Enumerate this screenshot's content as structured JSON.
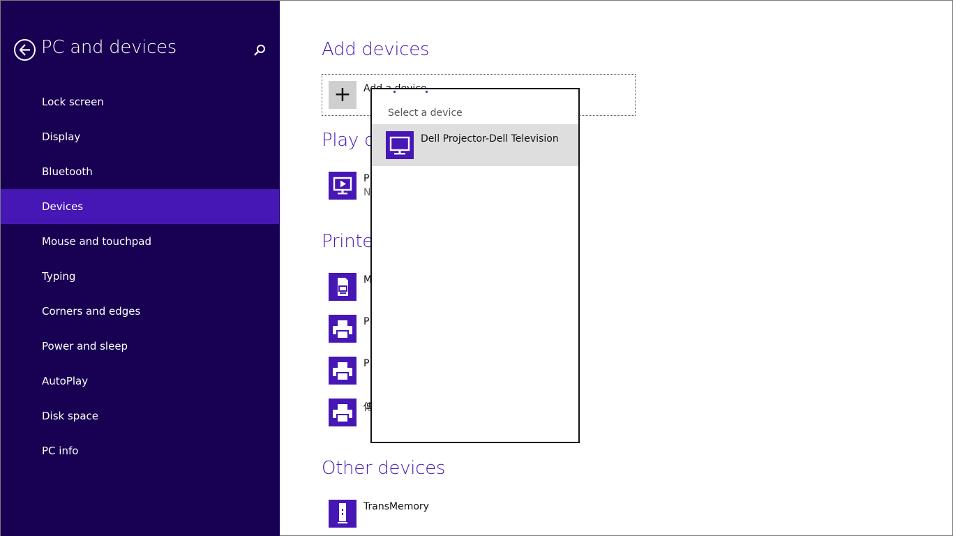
{
  "sidebar": {
    "title": "PC and devices",
    "items": [
      {
        "label": "Lock screen"
      },
      {
        "label": "Display"
      },
      {
        "label": "Bluetooth"
      },
      {
        "label": "Devices"
      },
      {
        "label": "Mouse and touchpad"
      },
      {
        "label": "Typing"
      },
      {
        "label": "Corners and edges"
      },
      {
        "label": "Power and sleep"
      },
      {
        "label": "AutoPlay"
      },
      {
        "label": "Disk space"
      },
      {
        "label": "PC info"
      }
    ],
    "active_item": "Devices"
  },
  "main": {
    "add_devices": {
      "heading": "Add devices",
      "add_label": "Add a device"
    },
    "play_devices": {
      "heading": "Play de",
      "items": [
        {
          "name": "P",
          "sub": "N",
          "icon": "media-player-icon"
        }
      ]
    },
    "printers": {
      "heading": "Printer",
      "items": [
        {
          "name": "M",
          "icon": "document-printer-icon"
        },
        {
          "name": "P",
          "icon": "printer-icon"
        },
        {
          "name": "P",
          "icon": "printer-icon"
        },
        {
          "name": "傳",
          "icon": "printer-icon"
        }
      ]
    },
    "other_devices": {
      "heading": "Other devices",
      "items": [
        {
          "name": "TransMemory",
          "icon": "usb-drive-icon"
        }
      ]
    }
  },
  "flyout": {
    "title": "Select a device",
    "items": [
      {
        "label": "Dell Projector-Dell Television",
        "icon": "monitor-icon"
      }
    ]
  },
  "colors": {
    "sidebar_bg": "#180052",
    "accent": "#4617b4",
    "selected_bg": "#dedede"
  }
}
